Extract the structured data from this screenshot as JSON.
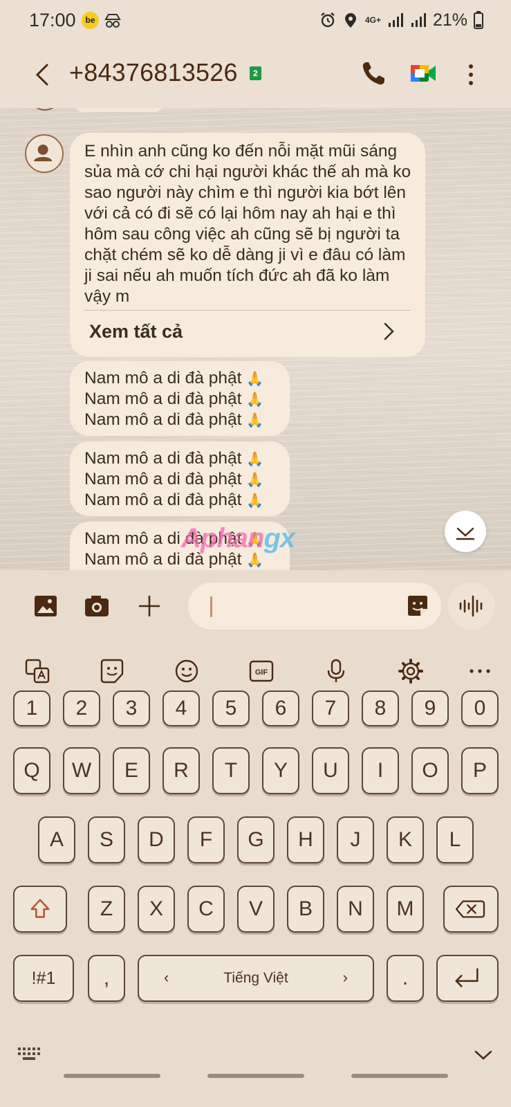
{
  "status_bar": {
    "time": "17:00",
    "app_badge": "be",
    "incognito_icon": "incognito-icon",
    "alarm_icon": "alarm-icon",
    "location_icon": "location-icon",
    "network": "4G+",
    "battery": "21%"
  },
  "header": {
    "back_icon": "back-arrow-icon",
    "contact": "+84376813526",
    "sim_badge": "2",
    "call_icon": "phone-icon",
    "video_icon": "google-meet-icon",
    "more_icon": "more-vertical-icon"
  },
  "conversation": {
    "long_message": "E nhìn anh cũng ko đến nỗi mặt mũi sáng sủa mà cớ chi  hại người khác thế ah mà ko sao người này chìm e thì người kia bớt lên với cả có đi sẽ có lại hôm nay ah hại e thì hôm sau công việc ah cũng sẽ bị người ta chặt chém sẽ ko dễ dàng ji vì e đâu có làm ji sai nếu ah muốn tích đức ah đã ko làm vậy m",
    "see_all": "Xem tất cả",
    "pray_text": "Nam mô a di đà phật",
    "pray_emoji": "🙏",
    "watermark_a": "Aphan",
    "watermark_b": "gx"
  },
  "compose": {
    "gallery_icon": "image-icon",
    "camera_icon": "camera-icon",
    "add_icon": "plus-icon",
    "sticker_icon": "sticker-icon",
    "voice_icon": "voice-waveform-icon"
  },
  "keyboard": {
    "number_row": [
      "1",
      "2",
      "3",
      "4",
      "5",
      "6",
      "7",
      "8",
      "9",
      "0"
    ],
    "row1": [
      "Q",
      "W",
      "E",
      "R",
      "T",
      "Y",
      "U",
      "I",
      "O",
      "P"
    ],
    "row2": [
      "A",
      "S",
      "D",
      "F",
      "G",
      "H",
      "J",
      "K",
      "L"
    ],
    "row3": [
      "Z",
      "X",
      "C",
      "V",
      "B",
      "N",
      "M"
    ],
    "symbols_key": "!#1",
    "comma_key": ",",
    "language": "Tiếng Việt",
    "lang_left": "‹",
    "lang_right": "›",
    "period_key": "."
  },
  "colors": {
    "accent_brown": "#4b2a12",
    "bubble": "#f7ebdd",
    "background": "#e8dccf"
  }
}
